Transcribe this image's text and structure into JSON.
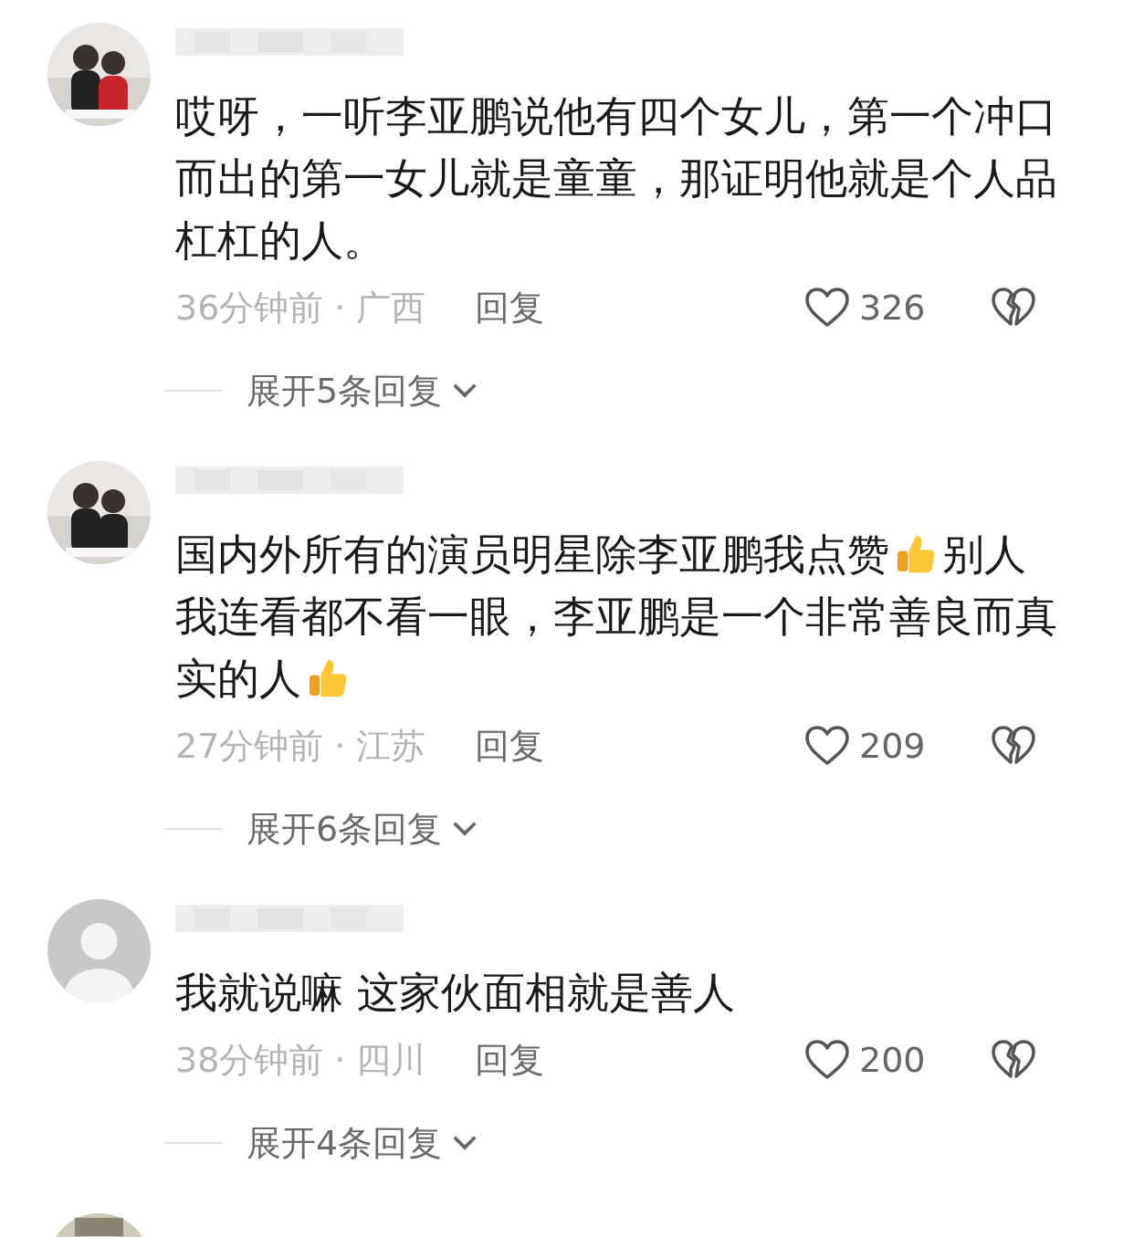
{
  "comments": [
    {
      "content": [
        {
          "kind": "text",
          "text": "哎呀，一听李亚鹏说他有四个女儿，第一个冲口而出的第一女儿就是童童，那证明他就是个人品杠杠的人。"
        }
      ],
      "time": "36分钟前",
      "separator": "·",
      "location": "广西",
      "reply_label": "回复",
      "likes": "326",
      "expand_label": "展开5条回复"
    },
    {
      "content": [
        {
          "kind": "text",
          "text": "国内外所有的演员明星除李亚鹏我点赞"
        },
        {
          "kind": "emoji"
        },
        {
          "kind": "text",
          "text": "别人我连看都不看一眼，李亚鹏是一个非常善良而真实的人"
        },
        {
          "kind": "emoji"
        }
      ],
      "time": "27分钟前",
      "separator": "·",
      "location": "江苏",
      "reply_label": "回复",
      "likes": "209",
      "expand_label": "展开6条回复"
    },
    {
      "avatar": {
        "kind": "default"
      },
      "content": [
        {
          "kind": "text",
          "text": "我就说嘛 这家伙面相就是善人"
        }
      ],
      "time": "38分钟前",
      "separator": "·",
      "location": "四川",
      "reply_label": "回复",
      "likes": "200",
      "expand_label": "展开4条回复"
    }
  ]
}
